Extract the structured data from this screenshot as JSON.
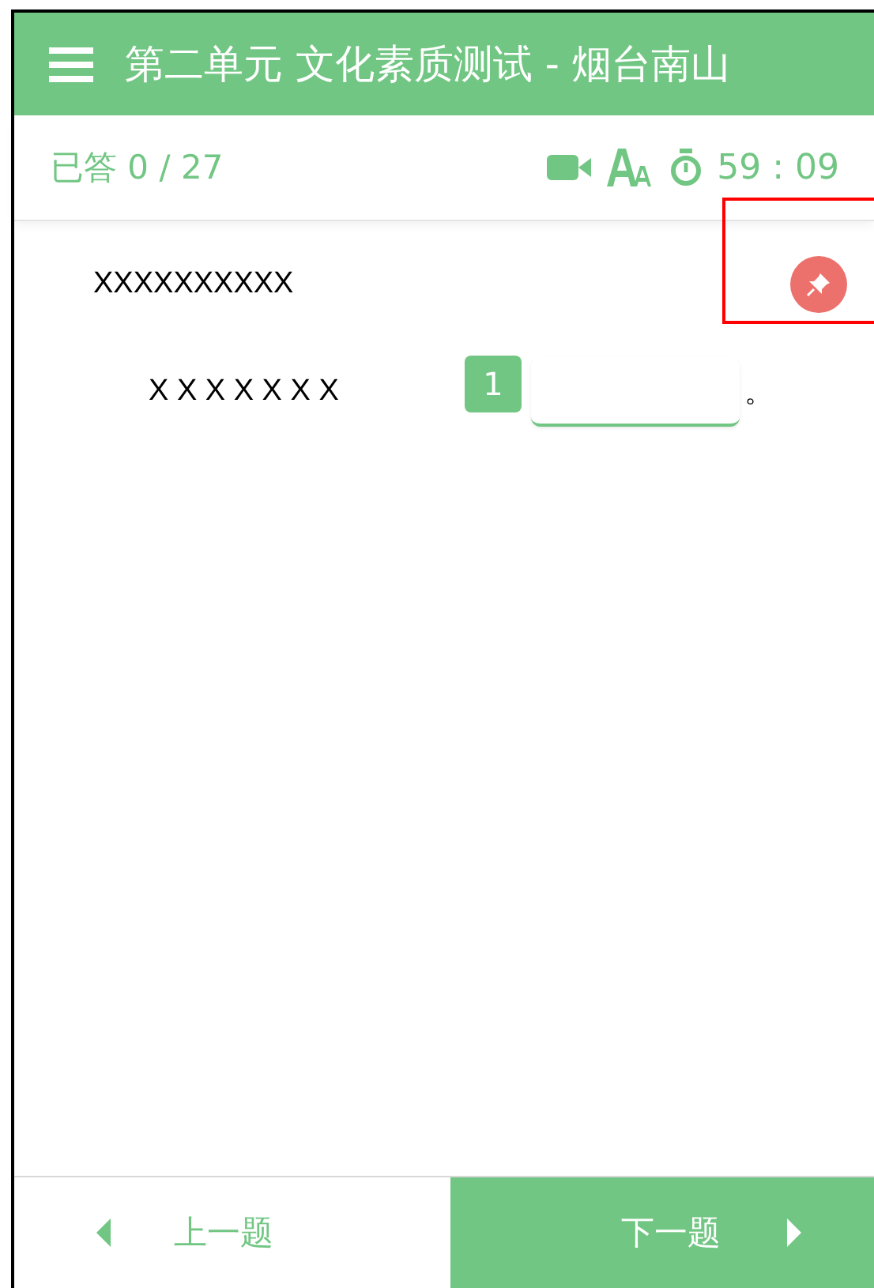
{
  "header": {
    "title": "第二单元 文化素质测试 - 烟台南山"
  },
  "toolbar": {
    "answered_label": "已答",
    "answered": "0 / 27",
    "timer": "59 : 09"
  },
  "question": {
    "title": "XXXXXXXXXX",
    "stem": "X X X X X X X",
    "blank_number": "1",
    "ending": "。"
  },
  "nav": {
    "prev": "上一题",
    "next": "下一题"
  }
}
